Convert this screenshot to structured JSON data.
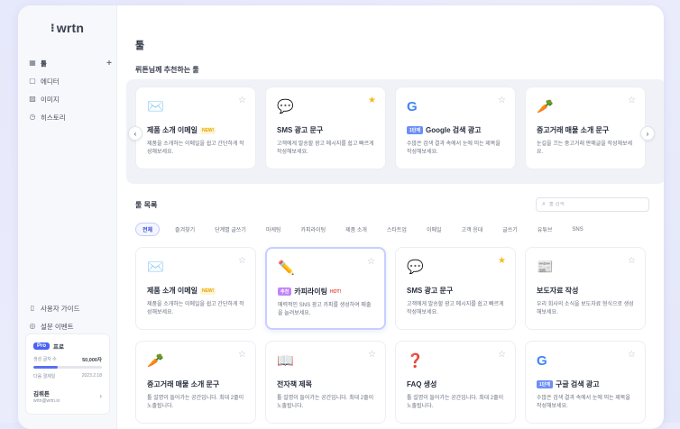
{
  "app": {
    "logo": "wrtn"
  },
  "sidebar": {
    "items": [
      {
        "icon": "grid-icon",
        "label": "툴",
        "active": true
      },
      {
        "icon": "document-icon",
        "label": "에디터"
      },
      {
        "icon": "image-icon",
        "label": "이미지"
      },
      {
        "icon": "clock-icon",
        "label": "히스토리"
      }
    ],
    "bottom_items": [
      {
        "icon": "book-icon",
        "label": "사용자 가이드"
      },
      {
        "icon": "gift-icon",
        "label": "설문 이벤트"
      }
    ],
    "plan": {
      "badge": "Pro",
      "name": "프로",
      "usage_label": "생성 글자 수",
      "usage_value": "50,000자",
      "usage_fraction": 0.35,
      "renew_label": "다음 결제일",
      "renew_date": "2023.2.18"
    },
    "user": {
      "name": "김뤼튼",
      "email": "wrtn@wrtn.io"
    }
  },
  "main": {
    "title": "툴",
    "recommend_title": "뤼튼님께 추천하는 툴",
    "list_title": "툴 목록",
    "search_placeholder": "툴 검색",
    "filters": [
      "전체",
      "즐겨찾기",
      "단계별 글쓰기",
      "마케팅",
      "카피라이팅",
      "제품 소개",
      "스타트업",
      "이메일",
      "고객 응대",
      "글쓰기",
      "유튜브",
      "SNS"
    ]
  },
  "recommended": [
    {
      "emoji": "✉️",
      "title": "제품 소개 이메일",
      "tag": "NEW!",
      "tag_type": "new",
      "desc": "제품을 소개하는 이메일을 쉽고 간단하게 작성해보세요.",
      "starred": false
    },
    {
      "emoji": "💬",
      "title": "SMS 광고 문구",
      "tag": "",
      "tag_type": "",
      "desc": "고객에게 발송할 광고 메시지를 쉽고 빠르게 작성해보세요.",
      "starred": true
    },
    {
      "emoji": "G",
      "title": "Google 검색 광고",
      "tag": "1단계",
      "tag_type": "pill-blue",
      "desc": "수많은 검색 결과 속에서 눈에 띄는 제목을 작성해보세요.",
      "starred": false
    },
    {
      "emoji": "🥕",
      "title": "중고거래 매물 소개 문구",
      "tag": "",
      "tag_type": "",
      "desc": "눈길을 끄는 중고거래 판매글을 작성해보세요.",
      "starred": false
    }
  ],
  "tools": [
    {
      "emoji": "✉️",
      "title": "제품 소개 이메일",
      "tag": "NEW!",
      "tag_type": "new",
      "desc": "제품을 소개하는 이메일을 쉽고 간단하게 작성해보세요.",
      "starred": false
    },
    {
      "emoji": "✏️",
      "title": "카피라이팅",
      "tag": "HOT!",
      "tag_type": "hot",
      "pre_tag": "추천",
      "desc": "매력적인 SNS 광고 카피를 생성하여 매출을 늘려보세요.",
      "starred": false,
      "selected": true
    },
    {
      "emoji": "💬",
      "title": "SMS 광고 문구",
      "tag": "",
      "tag_type": "",
      "desc": "고객에게 발송할 광고 메시지를 쉽고 빠르게 작성해보세요.",
      "starred": true
    },
    {
      "emoji": "📰",
      "title": "보도자료 작성",
      "tag": "",
      "tag_type": "",
      "desc": "우리 회사의 소식을 보도자료 형식으로 생성해보세요.",
      "starred": false
    },
    {
      "emoji": "🥕",
      "title": "중고거래 매물 소개 문구",
      "tag": "",
      "tag_type": "",
      "desc": "툴 설명이 들어가는 공간입니다. 최대 2줄이 노출됩니다.",
      "starred": false
    },
    {
      "emoji": "📖",
      "title": "전자책 제목",
      "tag": "",
      "tag_type": "",
      "desc": "툴 설명이 들어가는 공간입니다. 최대 2줄이 노출됩니다.",
      "starred": false
    },
    {
      "emoji": "❓",
      "title": "FAQ 생성",
      "tag": "",
      "tag_type": "",
      "desc": "툴 설명이 들어가는 공간입니다. 최대 2줄이 노출됩니다.",
      "starred": false
    },
    {
      "emoji": "G",
      "title": "구글 검색 광고",
      "tag": "",
      "tag_type": "",
      "pre_tag": "1단계",
      "desc": "수많은 검색 결과 속에서 눈에 띄는 제목을 작성해보세요.",
      "starred": false
    }
  ],
  "colors": {
    "accent": "#4a63f0",
    "star_on": "#f6b91c",
    "star_off": "#b8bcc8"
  }
}
